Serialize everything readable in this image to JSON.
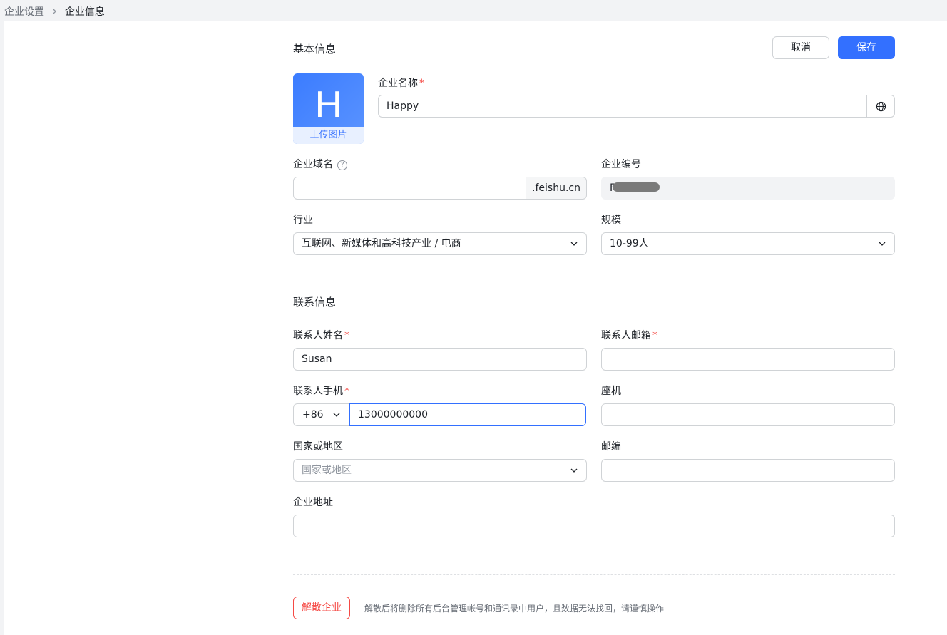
{
  "breadcrumb": {
    "parent": "企业设置",
    "current": "企业信息"
  },
  "basic": {
    "title": "基本信息",
    "cancel_label": "取消",
    "save_label": "保存",
    "avatar_letter": "H",
    "upload_label": "上传图片",
    "company_name_label": "企业名称",
    "company_name_value": "Happy",
    "domain_label": "企业域名",
    "domain_value": "",
    "domain_suffix": ".feishu.cn",
    "company_id_label": "企业编号",
    "company_id_visible_prefix": "F",
    "industry_label": "行业",
    "industry_value": "互联网、新媒体和高科技产业 / 电商",
    "scale_label": "规模",
    "scale_value": "10-99人"
  },
  "contact": {
    "title": "联系信息",
    "name_label": "联系人姓名",
    "name_value": "Susan",
    "email_label": "联系人邮箱",
    "email_value": "",
    "mobile_label": "联系人手机",
    "mobile_prefix": "+86",
    "mobile_value": "13000000000",
    "landline_label": "座机",
    "landline_value": "",
    "country_label": "国家或地区",
    "country_placeholder": "国家或地区",
    "postcode_label": "邮编",
    "postcode_value": "",
    "address_label": "企业地址",
    "address_value": ""
  },
  "danger": {
    "dissolve_label": "解散企业",
    "dissolve_tip": "解散后将删除所有后台管理帐号和通讯录中用户，且数据无法找回，请谨慎操作"
  },
  "colors": {
    "accent": "#3370ff",
    "danger": "#f54a45",
    "required": "#f54a45"
  },
  "icons": [
    "chevron-right-icon",
    "help-icon",
    "globe-icon",
    "chevron-down-icon"
  ]
}
